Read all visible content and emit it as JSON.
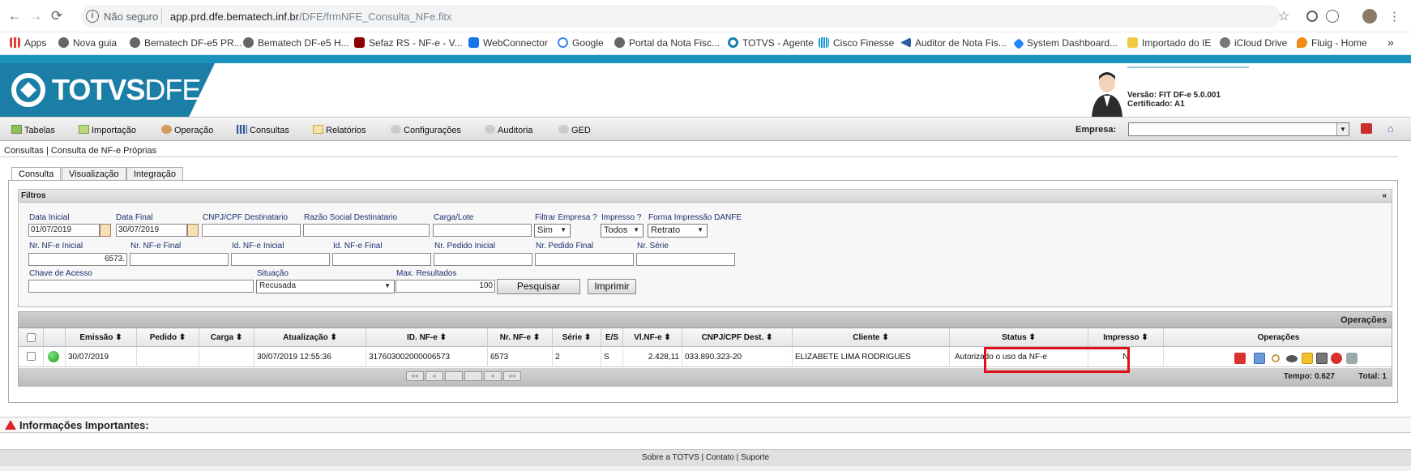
{
  "browser": {
    "back": "←",
    "forward": "→",
    "reload": "⟳",
    "info_icon": "i",
    "insecure_label": "Não seguro",
    "url_host": "app.prd.dfe.bematech.inf.br",
    "url_path": "/DFE/frmNFE_Consulta_NFe.fitx",
    "star": "☆",
    "more": "»",
    "bookmarks": [
      {
        "label": "Apps",
        "color": "#e33f3f"
      },
      {
        "label": "Nova guia",
        "color": "#666666"
      },
      {
        "label": "Bematech DF-e5 PR...",
        "color": "#666666"
      },
      {
        "label": "Bematech DF-e5 H...",
        "color": "#666666"
      },
      {
        "label": "Sefaz RS - NF-e - V...",
        "color": "#8b0000"
      },
      {
        "label": "WebConnector",
        "color": "#1a73e8"
      },
      {
        "label": "Google",
        "color": "#4285f4"
      },
      {
        "label": "Portal da Nota Fisc...",
        "color": "#666666"
      },
      {
        "label": "TOTVS - Agente",
        "color": "#1a7fb5"
      },
      {
        "label": "Cisco Finesse",
        "color": "#1d9bd1"
      },
      {
        "label": "Auditor de Nota Fis...",
        "color": "#2c5aa0"
      },
      {
        "label": "System Dashboard...",
        "color": "#2684ff"
      },
      {
        "label": "Importado do IE",
        "color": "#f2c744"
      },
      {
        "label": "iCloud Drive",
        "color": "#777777"
      },
      {
        "label": "Fluig - Home",
        "color": "#f08c1a"
      }
    ]
  },
  "header": {
    "logo_bold": "TOTVS",
    "logo_light": "DFE",
    "version": "Versão: FIT DF-e 5.0.001",
    "certificate": "Certificado: A1"
  },
  "menu": {
    "items": [
      {
        "label": "Tabelas",
        "icon": "table-icon",
        "color": "#6a8d3a"
      },
      {
        "label": "Importação",
        "icon": "import-icon",
        "color": "#7ba84a"
      },
      {
        "label": "Operação",
        "icon": "operation-icon",
        "color": "#b36b2b"
      },
      {
        "label": "Consultas",
        "icon": "grid-icon",
        "color": "#3a5a8d"
      },
      {
        "label": "Relatórios",
        "icon": "report-icon",
        "color": "#c9a64a"
      },
      {
        "label": "Configurações",
        "icon": "gear-icon",
        "color": "#aaaaaa"
      },
      {
        "label": "Auditoria",
        "icon": "audit-icon",
        "color": "#aaaaaa"
      },
      {
        "label": "GED",
        "icon": "ged-icon",
        "color": "#aaaaaa"
      }
    ],
    "empresa_label": "Empresa:",
    "empresa_value": ""
  },
  "breadcrumb": "Consultas | Consulta de NF-e Próprias",
  "tabs": [
    "Consulta",
    "Visualização",
    "Integração"
  ],
  "filters": {
    "title": "Filtros",
    "collapse": "«",
    "data_inicial_label": "Data Inicial",
    "data_inicial": "01/07/2019",
    "data_final_label": "Data Final",
    "data_final": "30/07/2019",
    "cnpj_label": "CNPJ/CPF Destinatario",
    "razao_label": "Razão Social Destinatario",
    "carga_label": "Carga/Lote",
    "filtrar_empresa_label": "Filtrar Empresa ?",
    "filtrar_empresa": "Sim",
    "impresso_label": "Impresso ?",
    "impresso": "Todos",
    "forma_label": "Forma Impressão DANFE",
    "forma": "Retrato",
    "nr_inicial_label": "Nr. NF-e Inicial",
    "nr_inicial": "6573.",
    "nr_final_label": "Nr. NF-e Final",
    "id_inicial_label": "Id. NF-e Inicial",
    "id_final_label": "Id. NF-e Final",
    "pedido_inicial_label": "Nr. Pedido Inicial",
    "pedido_final_label": "Nr. Pedido Final",
    "serie_label": "Nr. Série",
    "chave_label": "Chave de Acesso",
    "situacao_label": "Situação",
    "situacao": "Recusada",
    "max_label": "Max. Resultados",
    "max": "100",
    "pesquisar": "Pesquisar",
    "imprimir": "Imprimir"
  },
  "grid": {
    "caption": "Operações",
    "columns": [
      "Emissão ⬍",
      "Pedido ⬍",
      "Carga ⬍",
      "Atualização ⬍",
      "ID. NF-e ⬍",
      "Nr. NF-e ⬍",
      "Série ⬍",
      "E/S",
      "Vl.NF-e ⬍",
      "CNPJ/CPF Dest. ⬍",
      "Cliente ⬍",
      "Status ⬍",
      "Impresso ⬍",
      "Operações"
    ],
    "row": {
      "emissao": "30/07/2019",
      "pedido": "",
      "carga": "",
      "atualizacao": "30/07/2019 12:55:36",
      "id_nfe": "317603002000006573",
      "nr_nfe": "6573",
      "serie": "2",
      "es": "S",
      "valor": "2.428,11",
      "cnpj": "033.890.323-20",
      "cliente": "ELIZABETE LIMA RODRIGUES",
      "status": "Autorizado o uso da NF-e",
      "impresso": "N"
    },
    "pager": [
      "««",
      "«",
      "",
      "»",
      "»»"
    ],
    "tempo": "Tempo: 0.627",
    "total": "Total: 1"
  },
  "info_title": "Informações Importantes:",
  "footer": {
    "sobre": "Sobre a TOTVS",
    "contato": "Contato",
    "suporte": "Suporte",
    "sep": "|"
  }
}
